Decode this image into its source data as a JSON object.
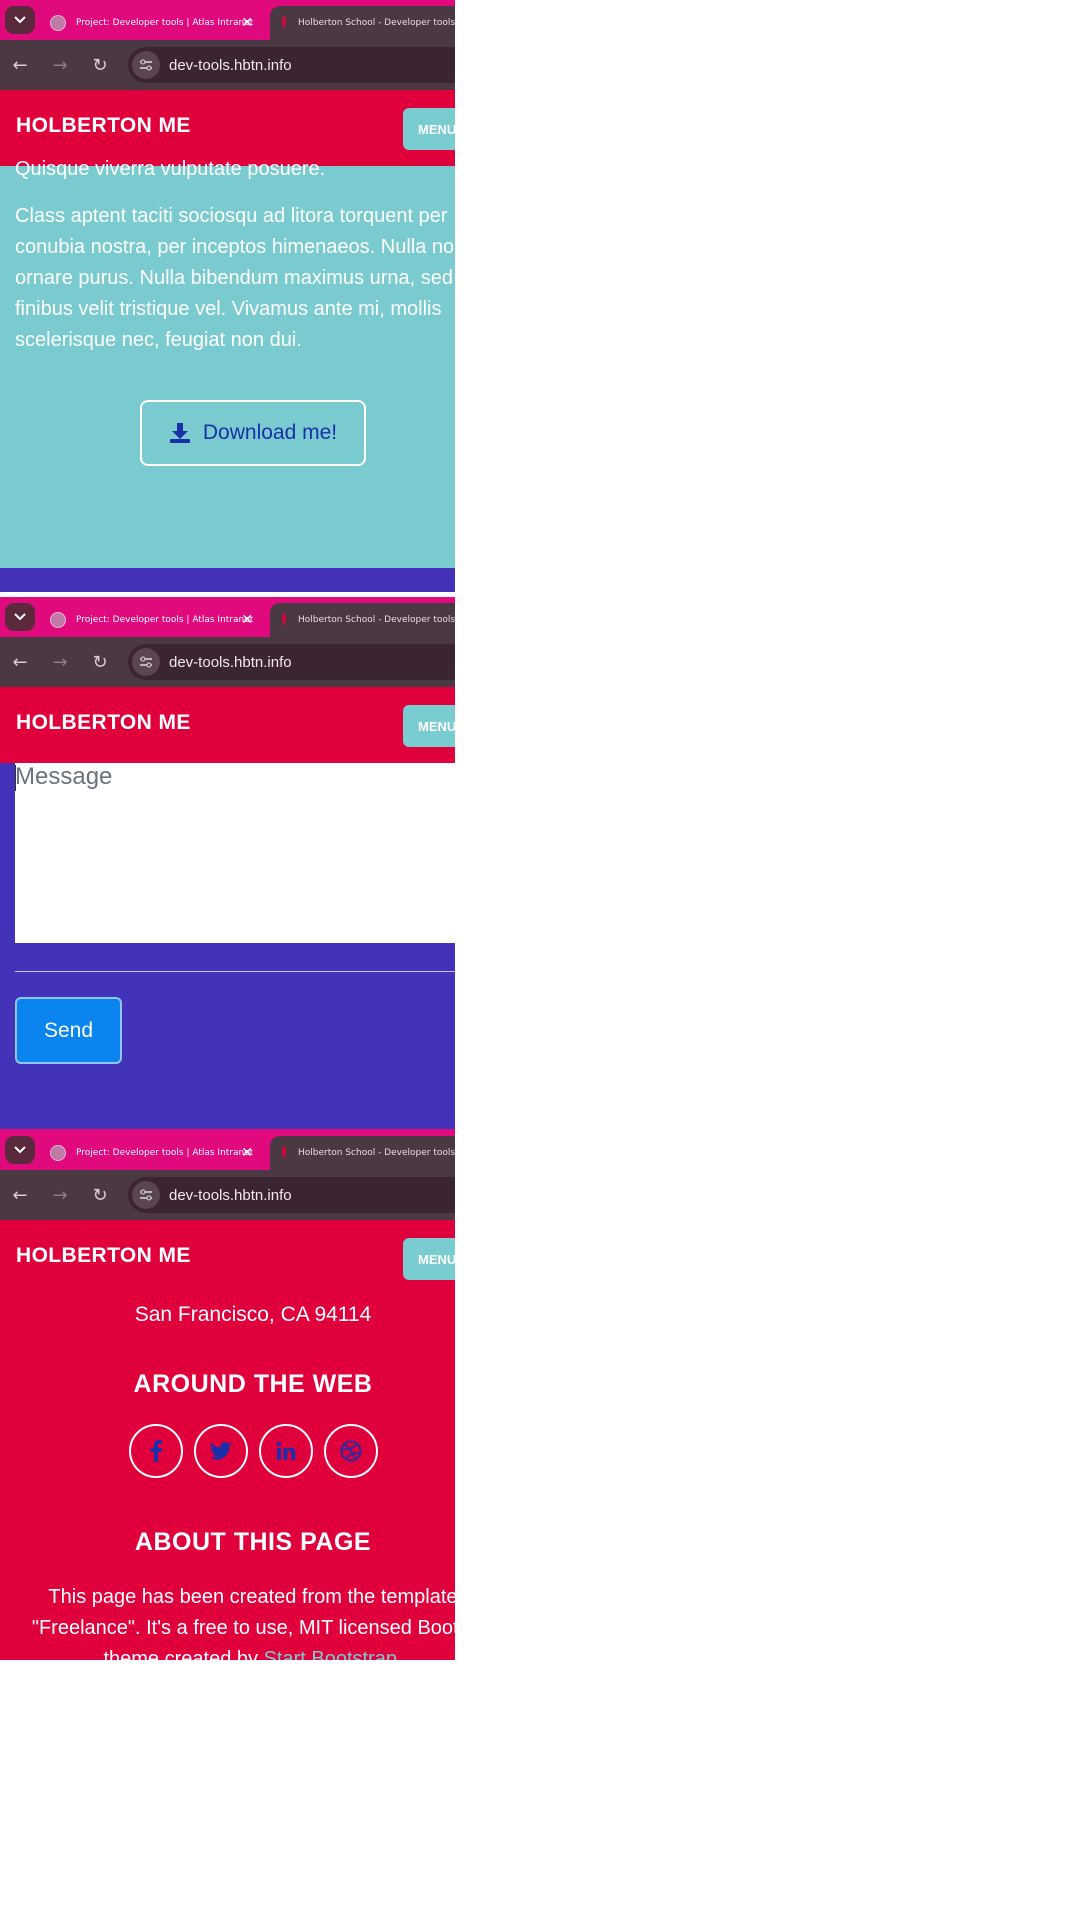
{
  "browser": {
    "tabs": [
      {
        "title": "Project: Developer tools | Atlas Intranet",
        "active": true
      },
      {
        "title": "Holberton School - Developer tools",
        "active": false
      }
    ],
    "url": "dev-tools.hbtn.info",
    "icons": {
      "tab_menu": "chevron-down-icon",
      "back": "arrow-left-icon",
      "forward": "arrow-right-icon",
      "reload": "reload-icon",
      "site_info": "tune-icon",
      "close_tab": "close-icon"
    }
  },
  "navbar": {
    "brand": "HOLBERTON ME",
    "menu_label": "MENU"
  },
  "about_section": {
    "paragraph_tail": "Quisque viverra vulputate posuere.",
    "paragraph_lines": [
      "Class aptent taciti sociosqu ad litora torquent per",
      "conubia nostra, per inceptos himenaeos. Nulla no",
      "ornare purus. Nulla bibendum maximus urna, sed",
      "finibus velit tristique vel. Vivamus ante mi, mollis",
      "scelerisque nec, feugiat non dui."
    ],
    "download_button": "Download me!",
    "download_icon": "download-icon"
  },
  "contact_section": {
    "message_placeholder": "Message",
    "send_button": "Send"
  },
  "footer": {
    "address_line": "San Francisco, CA 94114",
    "around_heading": "AROUND THE WEB",
    "social_links": [
      {
        "name": "facebook-icon"
      },
      {
        "name": "twitter-icon"
      },
      {
        "name": "linkedin-icon"
      },
      {
        "name": "dribbble-icon"
      }
    ],
    "about_heading": "ABOUT THIS PAGE",
    "about_lines": [
      "This page has been created from the template",
      "\"Freelance\". It's a free to use, MIT licensed Bootst"
    ],
    "about_line3_prefix": "theme created by ",
    "about_link": "Start Bootstrap",
    "about_line3_suffix": "."
  },
  "colors": {
    "tab_pink": "#e0097e",
    "nav_red": "#e0003c",
    "teal": "#7acbd0",
    "purple": "#4233b9",
    "send_blue": "#0a85f0",
    "dark_blue_text": "#1a2fa8"
  }
}
